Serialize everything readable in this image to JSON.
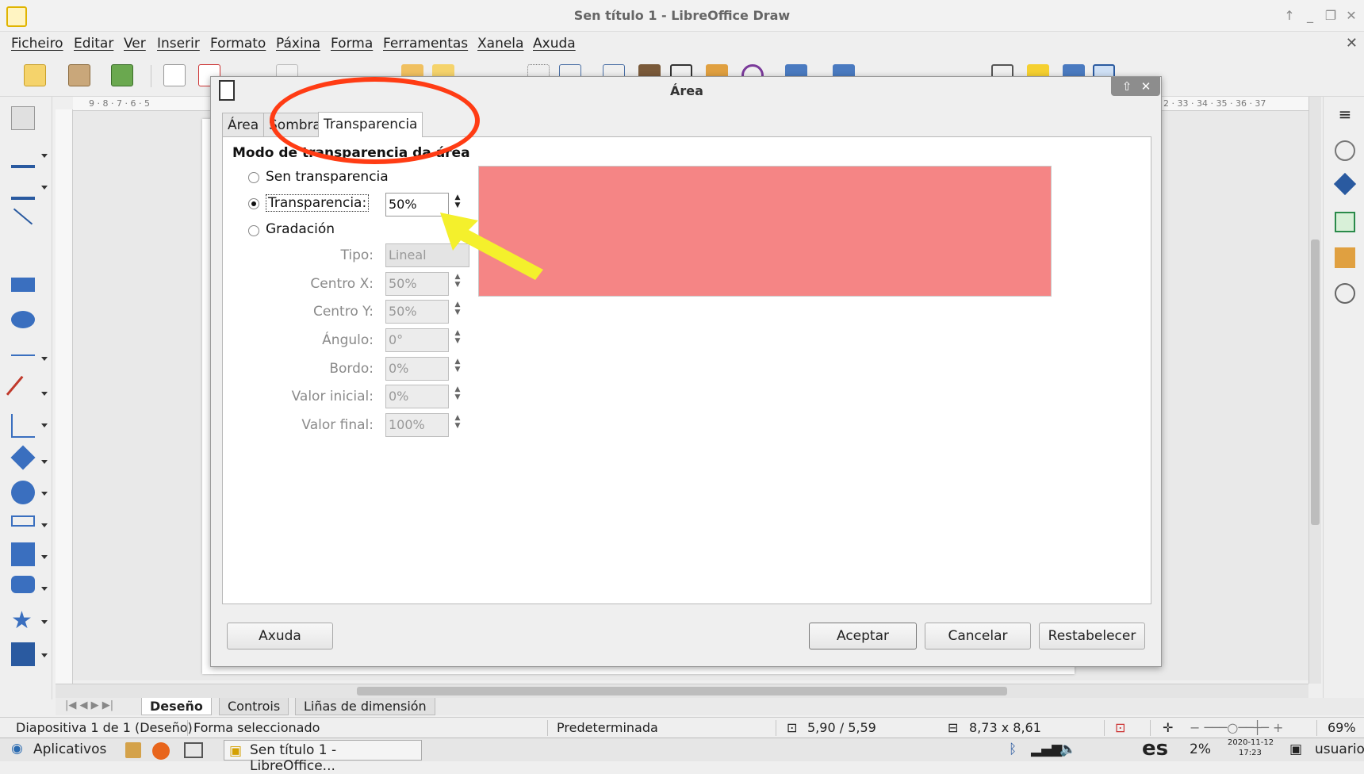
{
  "window": {
    "title": "Sen título 1 - LibreOffice Draw"
  },
  "menu": [
    "Ficheiro",
    "Editar",
    "Ver",
    "Inserir",
    "Formato",
    "Páxina",
    "Forma",
    "Ferramentas",
    "Xanela",
    "Axuda"
  ],
  "ruler": {
    "h_left": "9 · 8 · 7 · 6 · 5",
    "h_right": "2 · 33 · 34 · 35 · 36 · 37"
  },
  "dialog": {
    "title": "Área",
    "tabs": [
      "Área",
      "Sombra",
      "Transparencia"
    ],
    "active_tab": "Transparencia",
    "section_title": "Modo de transparencia da área",
    "options": {
      "none": "Sen transparencia",
      "transparency": "Transparencia:",
      "gradient": "Gradación"
    },
    "selected_option": "transparency",
    "transparency_value": "50%",
    "gradient_fields": {
      "type_label": "Tipo:",
      "type_value": "Lineal",
      "center_x_label": "Centro X:",
      "center_x_value": "50%",
      "center_y_label": "Centro Y:",
      "center_y_value": "50%",
      "angle_label": "Ángulo:",
      "angle_value": "0°",
      "border_label": "Bordo:",
      "border_value": "0%",
      "start_label": "Valor inicial:",
      "start_value": "0%",
      "end_label": "Valor final:",
      "end_value": "100%"
    },
    "preview_color": "#f58585",
    "buttons": {
      "help": "Axuda",
      "ok": "Aceptar",
      "cancel": "Cancelar",
      "reset": "Restabelecer"
    }
  },
  "bottom_tabs": [
    "Deseño",
    "Controis",
    "Liñas de dimensión"
  ],
  "status": {
    "slide": "Diapositiva 1 de 1 (Deseño)",
    "selection": "Forma seleccionado",
    "layout": "Predeterminada",
    "position": "5,90 / 5,59",
    "size": "8,73 x 8,61",
    "zoom": "69%"
  },
  "taskbar": {
    "apps": "Aplicativos",
    "window": "Sen título 1 - LibreOffice...",
    "lang": "es",
    "battery": "2%",
    "date": "2020-11-12",
    "time": "17:23",
    "user": "usuario"
  },
  "annotation_colors": {
    "ellipse": "#ff3c14",
    "arrow": "#f4f02c"
  }
}
